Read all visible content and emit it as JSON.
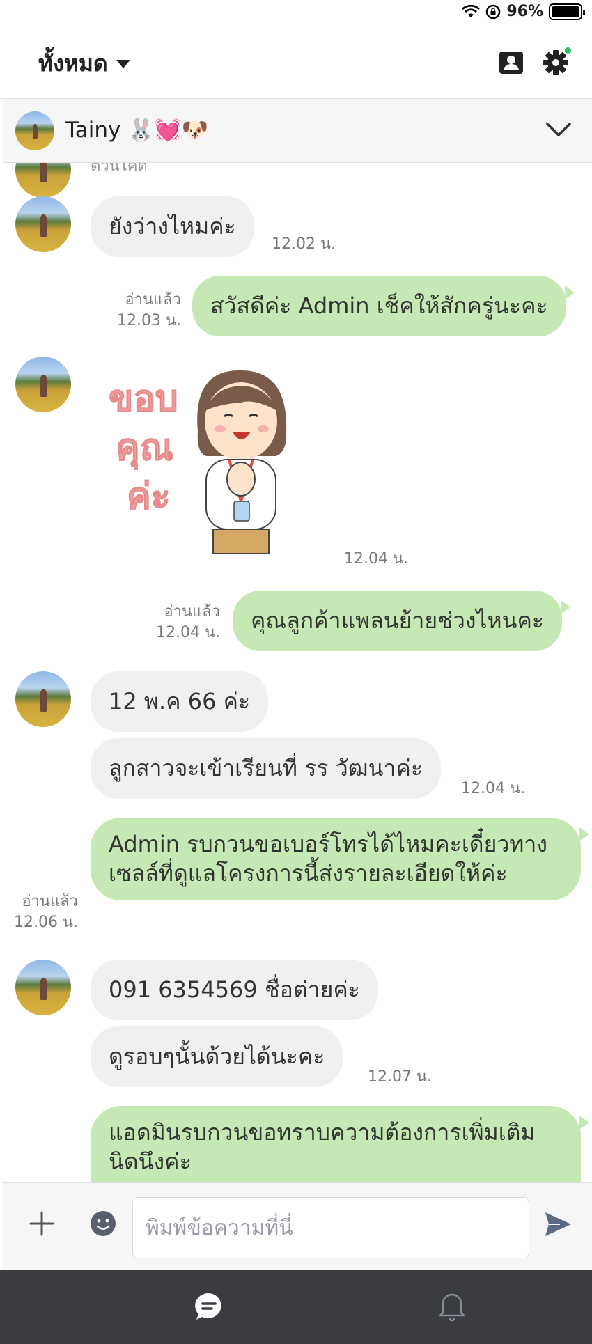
{
  "status_bar": {
    "battery": "96%"
  },
  "header": {
    "filter_label": "ทั้งหมด"
  },
  "chat": {
    "name": "Tainy 🐰💓🐶"
  },
  "messages": {
    "cut_top": "ตัวนไคด",
    "m1": {
      "text": "ยังว่างไหมค่ะ",
      "time": "12.02 น."
    },
    "m2": {
      "text": "สวัสดีค่ะ Admin เช็คให้สักครู่นะคะ",
      "read": "อ่านแล้ว",
      "time": "12.03 น."
    },
    "m3": {
      "sticker_text": [
        "ขอบ",
        "คุณ",
        "ค่ะ"
      ],
      "time": "12.04 น."
    },
    "m4": {
      "text": "คุณลูกค้าแพลนย้ายช่วงไหนคะ",
      "read": "อ่านแล้ว",
      "time": "12.04 น."
    },
    "m5": {
      "text": "12 พ.ค 66 ค่ะ"
    },
    "m6": {
      "text": "ลูกสาวจะเข้าเรียนที่ รร วัฒนาค่ะ",
      "time": "12.04 น."
    },
    "m7": {
      "text": "Admin รบกวนขอเบอร์โทรได้ไหมคะเดี๋ยวทางเซลล์ที่ดูแลโครงการนี้ส่งรายละเอียดให้ค่ะ",
      "read": "อ่านแล้ว",
      "time": "12.06 น."
    },
    "m8": {
      "text": "091 6354569 ชื่อต่ายค่ะ"
    },
    "m9": {
      "text": "ดูรอบๆนั้นด้วยได้นะคะ",
      "time": "12.07 น."
    },
    "m10": {
      "text": "แอดมินรบกวนขอทราบความต้องการเพิ่มเติมนิดนึงค่ะ"
    }
  },
  "composer": {
    "placeholder": "พิมพ์ข้อความที่นี่"
  },
  "colors": {
    "outgoing_bubble": "#c6e8b4",
    "incoming_bubble": "#f0f0f3",
    "nav_bg": "#3a3c41",
    "notify_dot": "#22c55e"
  },
  "icons": [
    "wifi-icon",
    "rotation-lock-icon",
    "battery-icon",
    "contact-card-icon",
    "gear-icon",
    "chevron-down-icon",
    "plus-icon",
    "emoji-icon",
    "send-icon",
    "chat-bubble-icon",
    "bell-icon"
  ]
}
